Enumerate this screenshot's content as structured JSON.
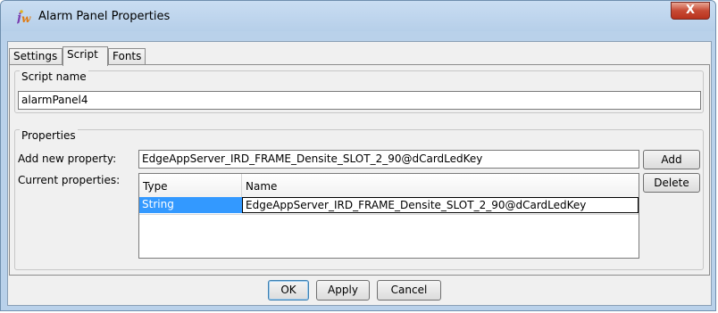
{
  "window": {
    "title": "Alarm Panel Properties",
    "close_label": "X",
    "icon": "jw-app-icon"
  },
  "tabs": [
    {
      "label": "Settings",
      "active": false
    },
    {
      "label": "Script",
      "active": true
    },
    {
      "label": "Fonts",
      "active": false
    }
  ],
  "script_name": {
    "group_label": "Script name",
    "value": "alarmPanel4"
  },
  "properties": {
    "group_label": "Properties",
    "add_label": "Add new property:",
    "add_value": "EdgeAppServer_IRD_FRAME_Densite_SLOT_2_90@dCardLedKey",
    "current_label": "Current properties:",
    "add_button": "Add",
    "delete_button": "Delete",
    "columns": [
      "Type",
      "Name"
    ],
    "rows": [
      {
        "type": "String",
        "name": "EdgeAppServer_IRD_FRAME_Densite_SLOT_2_90@dCardLedKey"
      }
    ]
  },
  "footer": {
    "ok": "OK",
    "apply": "Apply",
    "cancel": "Cancel"
  },
  "colors": {
    "title_bar": "#b9d1ea",
    "selection": "#3399ff",
    "close": "#c74a34"
  }
}
